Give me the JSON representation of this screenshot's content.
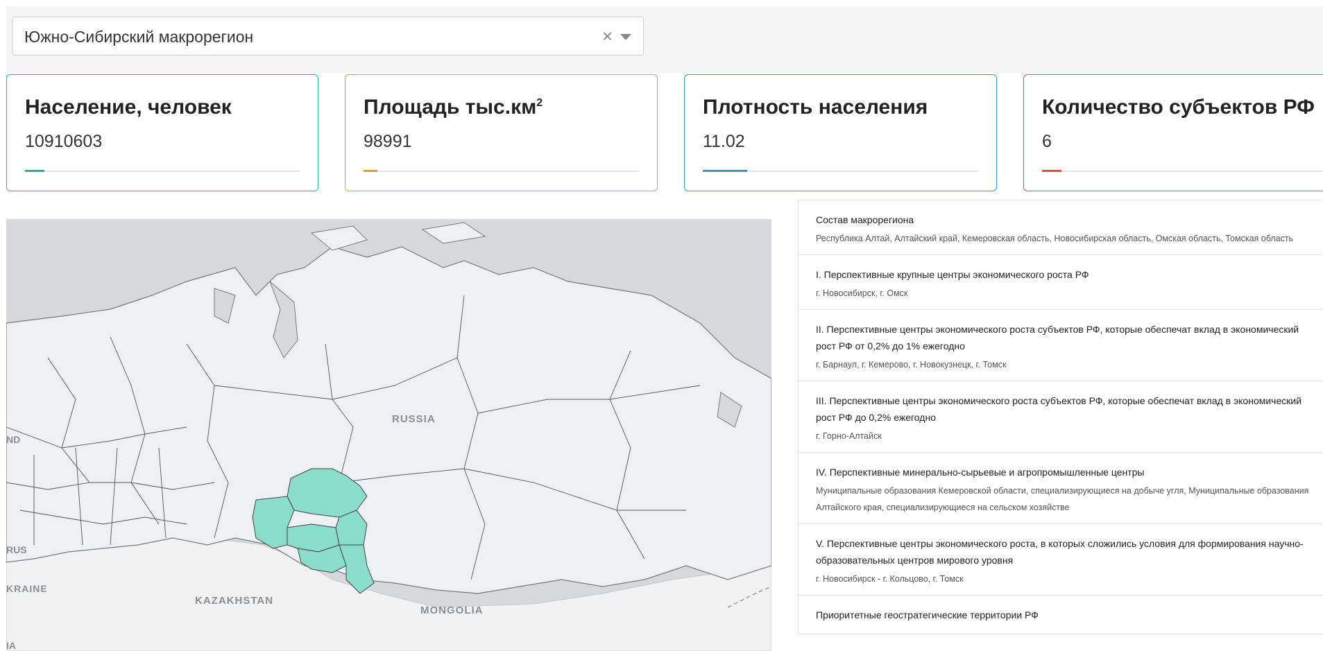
{
  "region_select": {
    "value": "Южно-Сибирский макрорегион",
    "clear_icon": "×"
  },
  "cards": [
    {
      "title": "Население, человек",
      "value": "10910603",
      "color": "#1abc9c",
      "progress": 0.07
    },
    {
      "title": "Площадь тыс.км",
      "title_sup": "2",
      "value": "98991",
      "color": "#f39c12",
      "progress": 0.05
    },
    {
      "title": "Плотность населения",
      "value": "11.02",
      "color": "#3498db",
      "progress": 0.16
    },
    {
      "title": "Количество субъектов РФ",
      "value": "6",
      "color": "#e74c3c",
      "progress": 0.07
    }
  ],
  "map": {
    "labels": {
      "russia": "RUSSIA",
      "kazakhstan": "KAZAKHSTAN",
      "mongolia": "MONGOLIA",
      "ukraine": "KRAINE",
      "rus": "RUS",
      "nd": "ND",
      "ia": "IA"
    },
    "highlight_color": "#8adccb"
  },
  "panel": {
    "items": [
      {
        "heading": "Состав макрорегиона",
        "detail": "Республика Алтай, Алтайский край, Кемеровская область, Новосибирская область, Омская область, Томская область"
      },
      {
        "heading": "I. Перспективные крупные центры экономического роста РФ",
        "detail": "г. Новосибирск, г. Омск"
      },
      {
        "heading": "II. Перспективные центры экономического роста субъектов РФ, которые обеспечат вклад в экономический рост РФ от 0,2% до 1% ежегодно",
        "detail": "г. Барнаул, г. Кемерово, г. Новокузнецк, г. Томск"
      },
      {
        "heading": "III. Перспективные центры экономического роста субъектов РФ, которые обеспечат вклад в экономический рост РФ до 0,2% ежегодно",
        "detail": "г. Горно-Алтайск"
      },
      {
        "heading": "IV. Перспективные минерально-сырьевые и агропромышленные центры",
        "detail": "Муниципальные образования Кемеровской области, специализирующиеся на добыче угля, Муниципальные образования Алтайского края, специализирующиеся на сельском хозяйстве"
      },
      {
        "heading": "V. Перспективные центры экономического роста, в которых сложились условия для формирования научно-образовательных центров мирового уровня",
        "detail": "г. Новосибирск - г. Кольцово, г. Томск"
      },
      {
        "heading": "Приоритетные геостратегические территории РФ"
      }
    ]
  }
}
